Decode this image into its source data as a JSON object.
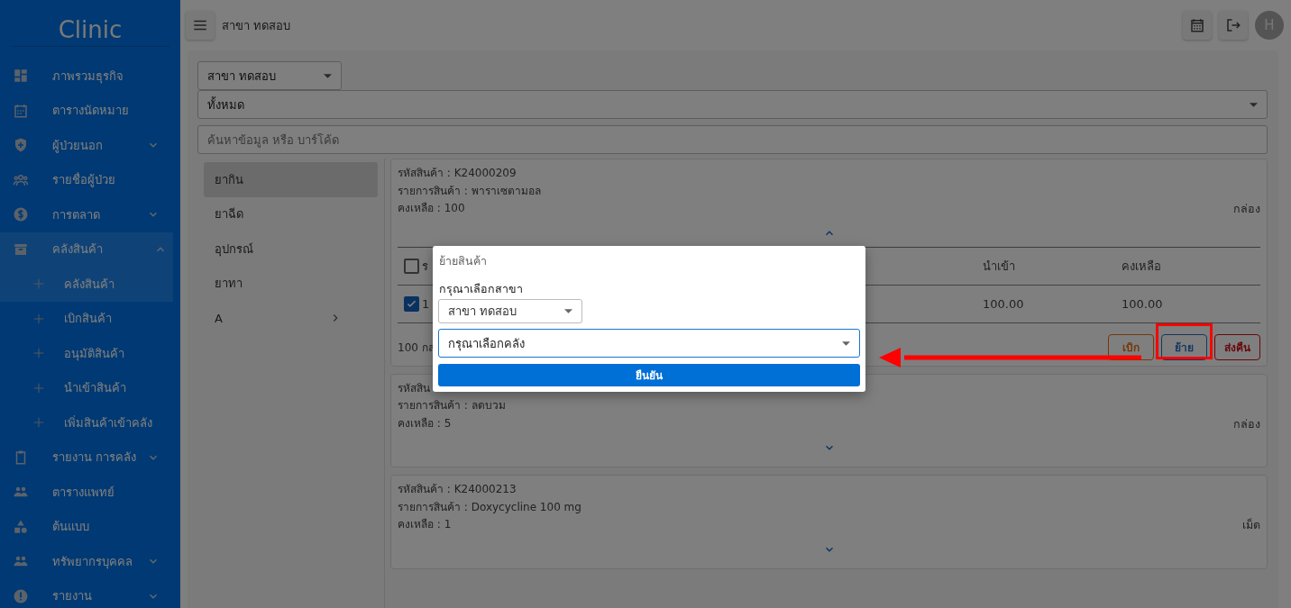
{
  "sidebar": {
    "logo": "Clinic",
    "items": [
      {
        "label": "ภาพรวมธุรกิจ",
        "selected": false
      },
      {
        "label": "ตารางนัดหมาย",
        "selected": false
      },
      {
        "label": "ผู้ป่วยนอก",
        "selected": false,
        "expanded": false
      },
      {
        "label": "รายชื่อผู้ป่วย",
        "selected": false
      },
      {
        "label": "การตลาด",
        "selected": false,
        "expanded": false
      },
      {
        "label": "คลังสินค้า",
        "selected": true,
        "expanded": true,
        "children": [
          {
            "label": "คลังสินค้า",
            "selected": true
          },
          {
            "label": "เบิกสินค้า",
            "selected": false
          },
          {
            "label": "อนุมัติสินค้า",
            "selected": false
          },
          {
            "label": "นำเข้าสินค้า",
            "selected": false
          },
          {
            "label": "เพิ่มสินค้าเข้าคลัง",
            "selected": false
          }
        ]
      },
      {
        "label": "รายงาน การคลัง",
        "selected": false,
        "expanded": false
      },
      {
        "label": "ตารางแพทย์",
        "selected": false
      },
      {
        "label": "ต้นแบบ",
        "selected": false
      },
      {
        "label": "ทรัพยากรบุคคล",
        "selected": false,
        "expanded": false
      },
      {
        "label": "รายงาน",
        "selected": false,
        "expanded": false
      }
    ]
  },
  "topbar": {
    "title": "สาขา ทดสอบ",
    "avatar": "H"
  },
  "filters": {
    "branch": "สาขา ทดสอบ",
    "type": "ทั้งหมด",
    "search": {
      "placeholder": "ค้นหาข้อมูล หรือ บาร์โค้ด"
    }
  },
  "categories": [
    {
      "label": "ยากิน",
      "selected": true,
      "submenu": false
    },
    {
      "label": "ยาฉีด",
      "selected": false,
      "submenu": false
    },
    {
      "label": "อุปกรณ์",
      "selected": false,
      "submenu": false
    },
    {
      "label": "ยาทา",
      "selected": false,
      "submenu": false
    },
    {
      "label": "A",
      "selected": false,
      "submenu": true
    }
  ],
  "products": [
    {
      "lines": [
        "รหัสสินค้า : K24000209",
        "รายการสินค้า : พาราเซตามอล",
        "คงเหลือ : 100"
      ],
      "unit": "กล่อง",
      "expanded": true,
      "table": {
        "all_checked": false,
        "columns": [
          "ร",
          "นำเข้า",
          "คงเหลือ"
        ],
        "rows": [
          {
            "checked": true,
            "cells": [
              "1",
              "100.00",
              "100.00"
            ]
          }
        ]
      },
      "footer": "100 กล",
      "actions": [
        {
          "label": "เบิก",
          "kind": "withdraw"
        },
        {
          "label": "ย้าย",
          "kind": "move"
        },
        {
          "label": "ส่งคืน",
          "kind": "return"
        }
      ]
    },
    {
      "lines": [
        "รหัสสิน",
        "รายการสินค้า : ลดบวม",
        "คงเหลือ : 5"
      ],
      "unit": "กล่อง",
      "expanded": false
    },
    {
      "lines": [
        "รหัสสินค้า : K24000213",
        "รายการสินค้า : Doxycycline 100 mg",
        "คงเหลือ : 1"
      ],
      "unit": "เม็ด",
      "expanded": false
    }
  ],
  "dialog": {
    "title": "ย้ายสินค้า",
    "branch_label": "กรุณาเลือกสาขา",
    "branch": "สาขา ทดสอบ",
    "warehouse": {
      "placeholder": "กรุณาเลือกคลัง"
    },
    "confirm": "ยืนยัน"
  }
}
